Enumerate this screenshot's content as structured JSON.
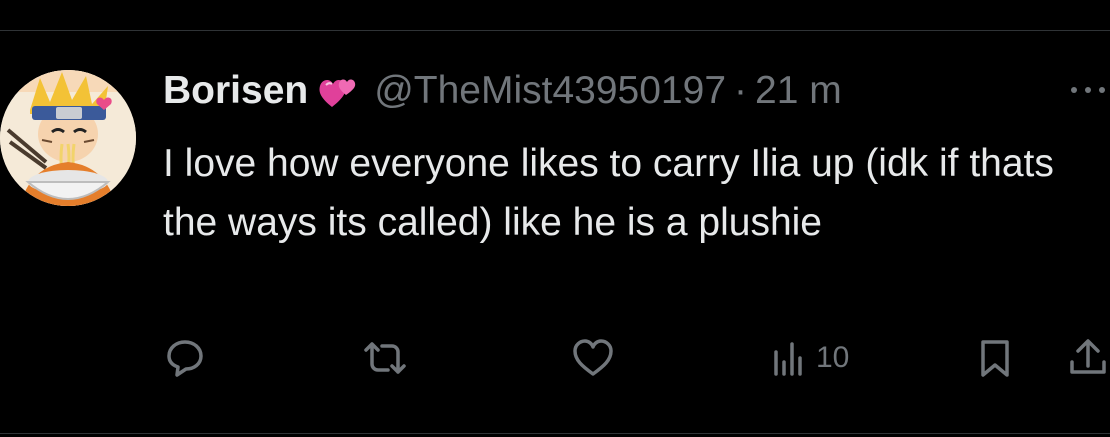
{
  "tweet": {
    "author_name": "Borisen",
    "handle": "@TheMist43950197",
    "separator": "·",
    "time": "21 m",
    "text": "I love how everyone likes to carry Ilia up (idk if thats the ways its called) like he is a plushie"
  },
  "icons": {
    "name_emoji": "two-hearts-icon",
    "more": "more-icon",
    "reply": "reply-icon",
    "retweet": "retweet-icon",
    "like": "like-icon",
    "views": "views-icon",
    "bookmark": "bookmark-icon",
    "share": "share-icon"
  },
  "actions": {
    "views_count": "10"
  },
  "colors": {
    "background": "#000000",
    "primary_text": "#e7e9ea",
    "secondary_text": "#71767b",
    "divider": "#2f3336",
    "emoji_heart": "#e0409a"
  }
}
